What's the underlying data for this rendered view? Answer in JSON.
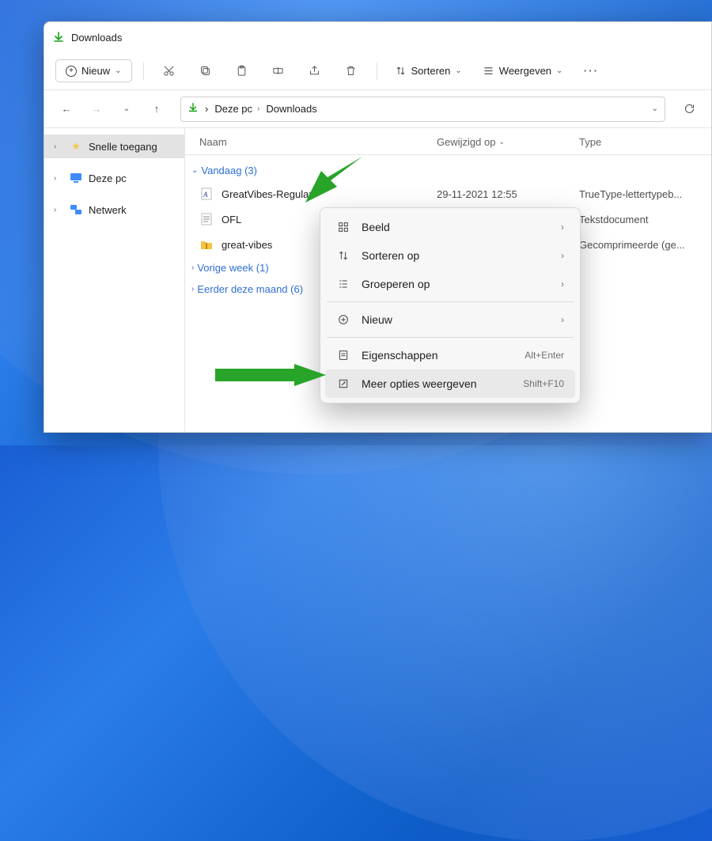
{
  "title": "Downloads",
  "toolbar": {
    "new_label": "Nieuw",
    "sort_label": "Sorteren",
    "view_label": "Weergeven"
  },
  "breadcrumb": {
    "seg1": "Deze pc",
    "seg2": "Downloads"
  },
  "sidebar": {
    "items": [
      {
        "label": "Snelle toegang"
      },
      {
        "label": "Deze pc"
      },
      {
        "label": "Netwerk"
      }
    ]
  },
  "columns": {
    "name": "Naam",
    "modified": "Gewijzigd op",
    "type": "Type"
  },
  "groups": {
    "today": "Vandaag (3)",
    "last_week": "Vorige week (1)",
    "earlier_month": "Eerder deze maand (6)"
  },
  "files": [
    {
      "name": "GreatVibes-Regular",
      "date": "29-11-2021 12:55",
      "type": "TrueType-lettertypeb..."
    },
    {
      "name": "OFL",
      "date": "",
      "type": "Tekstdocument"
    },
    {
      "name": "great-vibes",
      "date": "",
      "type": "Gecomprimeerde (ge..."
    }
  ],
  "ctx": {
    "view": "Beeld",
    "sort_by": "Sorteren op",
    "group_by": "Groeperen op",
    "new": "Nieuw",
    "properties": "Eigenschappen",
    "properties_k": "Alt+Enter",
    "more": "Meer opties weergeven",
    "more_k": "Shift+F10"
  }
}
